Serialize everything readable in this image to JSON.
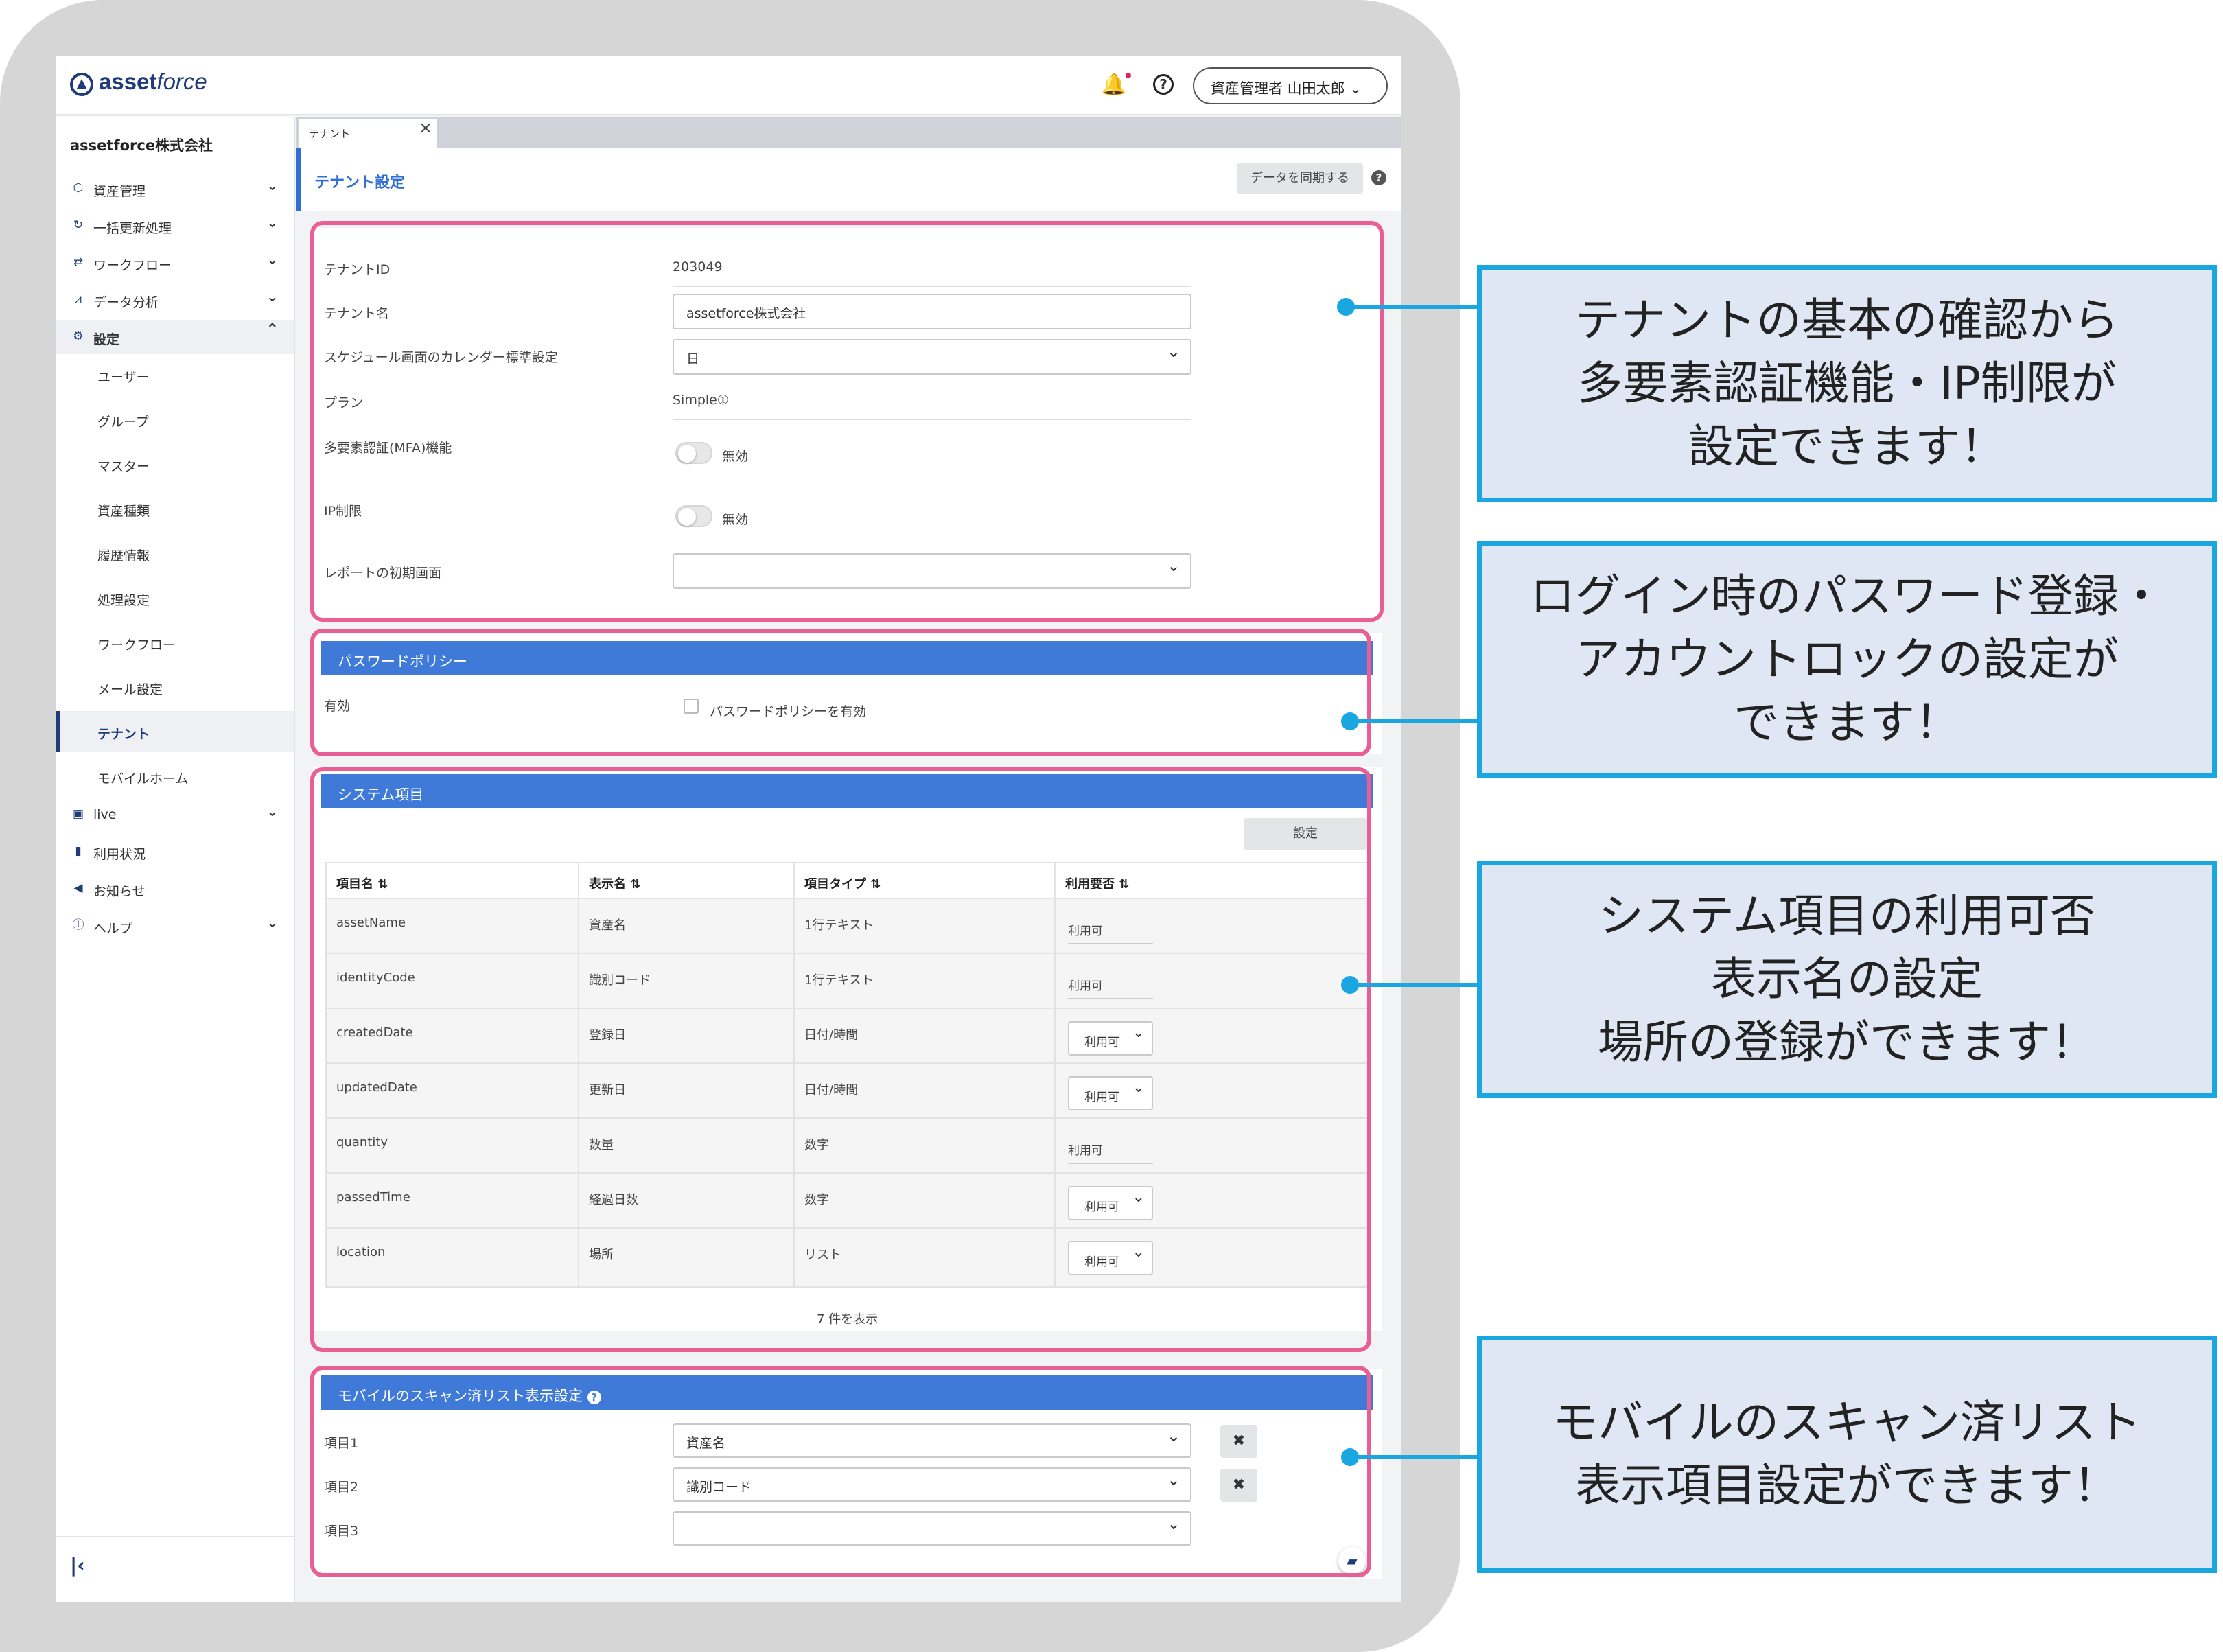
{
  "app": {
    "logo_bold": "asset",
    "logo_light": "force",
    "user_button": "資産管理者 山田太郎"
  },
  "sidebar": {
    "company": "assetforce株式会社",
    "items": [
      {
        "label": "資産管理",
        "icon": "cube-icon"
      },
      {
        "label": "一括更新処理",
        "icon": "refresh-icon"
      },
      {
        "label": "ワークフロー",
        "icon": "workflow-icon"
      },
      {
        "label": "データ分析",
        "icon": "analytics-icon"
      },
      {
        "label": "設定",
        "icon": "gear-icon"
      }
    ],
    "sub_items": [
      "ユーザー",
      "グループ",
      "マスター",
      "資産種類",
      "履歴情報",
      "処理設定",
      "ワークフロー",
      "メール設定",
      "テナント",
      "モバイルホーム"
    ],
    "bottom_items": [
      {
        "label": "live",
        "icon": "live-icon"
      },
      {
        "label": "利用状況",
        "icon": "bar-chart-icon"
      },
      {
        "label": "お知らせ",
        "icon": "megaphone-icon"
      },
      {
        "label": "ヘルプ",
        "icon": "help-icon"
      }
    ]
  },
  "tabs": [
    {
      "label": "テナント"
    }
  ],
  "page": {
    "title": "テナント設定",
    "sync_button": "データを同期する"
  },
  "tenant": {
    "id_label": "テナントID",
    "id_value": "203049",
    "name_label": "テナント名",
    "name_value": "assetforce株式会社",
    "calendar_label": "スケジュール画面のカレンダー標準設定",
    "calendar_value": "日",
    "plan_label": "プラン",
    "plan_value": "Simple①",
    "mfa_label": "多要素認証(MFA)機能",
    "mfa_state": "無効",
    "ip_label": "IP制限",
    "ip_state": "無効",
    "report_label": "レポートの初期画面",
    "report_value": ""
  },
  "password_policy": {
    "header": "パスワードポリシー",
    "enabled_label": "有効",
    "checkbox_label": "パスワードポリシーを有効"
  },
  "system_items": {
    "header": "システム項目",
    "settings_button": "設定",
    "columns": [
      "項目名 ⇅",
      "表示名 ⇅",
      "項目タイプ ⇅",
      "利用要否 ⇅"
    ],
    "rows": [
      {
        "name": "assetName",
        "display": "資産名",
        "type": "1行テキスト",
        "usage": "利用可",
        "editable": false
      },
      {
        "name": "identityCode",
        "display": "識別コード",
        "type": "1行テキスト",
        "usage": "利用可",
        "editable": false
      },
      {
        "name": "createdDate",
        "display": "登録日",
        "type": "日付/時間",
        "usage": "利用可",
        "editable": true
      },
      {
        "name": "updatedDate",
        "display": "更新日",
        "type": "日付/時間",
        "usage": "利用可",
        "editable": true
      },
      {
        "name": "quantity",
        "display": "数量",
        "type": "数字",
        "usage": "利用可",
        "editable": false
      },
      {
        "name": "passedTime",
        "display": "経過日数",
        "type": "数字",
        "usage": "利用可",
        "editable": true
      },
      {
        "name": "location",
        "display": "場所",
        "type": "リスト",
        "usage": "利用可",
        "editable": true
      }
    ],
    "count_text": "7 件を表示"
  },
  "mobile_scan": {
    "header": "モバイルのスキャン済リスト表示設定",
    "items": [
      {
        "label": "項目1",
        "value": "資産名",
        "removable": true
      },
      {
        "label": "項目2",
        "value": "識別コード",
        "removable": true
      },
      {
        "label": "項目3",
        "value": "",
        "removable": false
      }
    ]
  },
  "callouts": [
    {
      "lines": [
        "テナントの基本の確認から",
        "多要素認証機能・IP制限が",
        "設定できます！"
      ]
    },
    {
      "lines": [
        "ログイン時のパスワード登録・",
        "アカウントロックの設定が",
        "できます！"
      ]
    },
    {
      "lines": [
        "システム項目の利用可否",
        "表示名の設定",
        "場所の登録ができます！"
      ]
    },
    {
      "lines": [
        "モバイルのスキャン済リスト",
        "表示項目設定ができます！"
      ]
    }
  ],
  "colors": {
    "brand": "#1f3c78",
    "section_header": "#3f7ad8",
    "highlight_border": "#ea5f93",
    "callout_border": "#1aa6e0",
    "callout_fill": "#dfe7f4"
  }
}
